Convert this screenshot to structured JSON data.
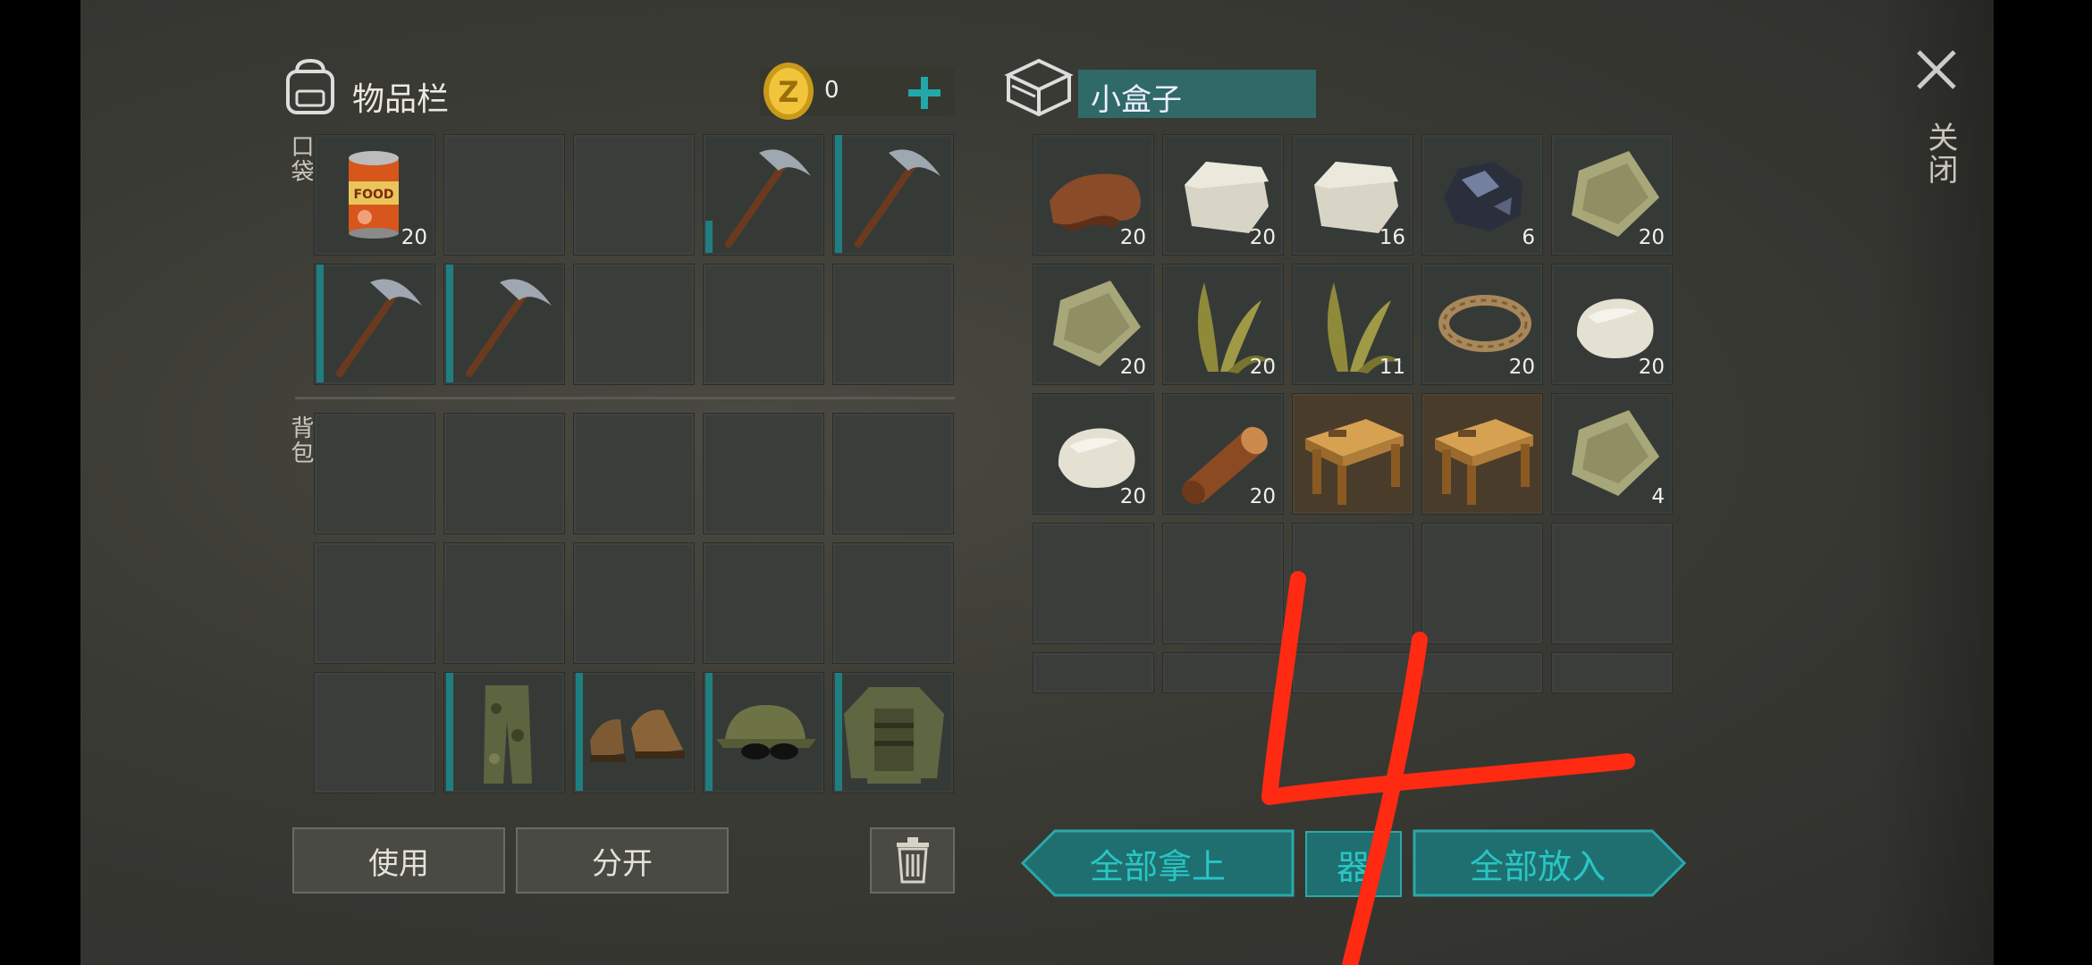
{
  "inventory": {
    "title": "物品栏",
    "coins": "0",
    "pocket_label": "口袋",
    "backpack_label": "背包",
    "pocket_slots": [
      {
        "item": "canned-food",
        "count": "20"
      },
      {
        "item": "",
        "count": ""
      },
      {
        "item": "",
        "count": ""
      },
      {
        "item": "pickaxe",
        "count": ""
      },
      {
        "item": "pickaxe",
        "count": ""
      },
      {
        "item": "pickaxe",
        "count": ""
      },
      {
        "item": "pickaxe",
        "count": ""
      },
      {
        "item": "",
        "count": ""
      },
      {
        "item": "",
        "count": ""
      },
      {
        "item": "",
        "count": ""
      }
    ],
    "equipment": [
      "camo-pants",
      "boots",
      "camo-cap-sunglasses",
      "camo-jacket"
    ],
    "use_label": "使用",
    "split_label": "分开"
  },
  "container": {
    "name": "小盒子",
    "slots": [
      {
        "item": "leather",
        "count": "20"
      },
      {
        "item": "stone",
        "count": "20"
      },
      {
        "item": "stone",
        "count": "16"
      },
      {
        "item": "iron-ore",
        "count": "6"
      },
      {
        "item": "cloth",
        "count": "20"
      },
      {
        "item": "cloth",
        "count": "20"
      },
      {
        "item": "plant-fiber",
        "count": "20"
      },
      {
        "item": "plant-fiber",
        "count": "11"
      },
      {
        "item": "rope",
        "count": "20"
      },
      {
        "item": "limestone",
        "count": "20"
      },
      {
        "item": "limestone",
        "count": "20"
      },
      {
        "item": "wood-log",
        "count": "20"
      },
      {
        "item": "workbench",
        "count": ""
      },
      {
        "item": "workbench",
        "count": ""
      },
      {
        "item": "cloth",
        "count": "4"
      }
    ],
    "take_all_label": "全部拿上",
    "put_all_label": "全部放入",
    "middle_label": "器"
  },
  "close_label": "关闭",
  "annotation": "4",
  "colors": {
    "accent": "#1f8585",
    "annotation": "#ff2a12",
    "slot": "#363a37"
  }
}
